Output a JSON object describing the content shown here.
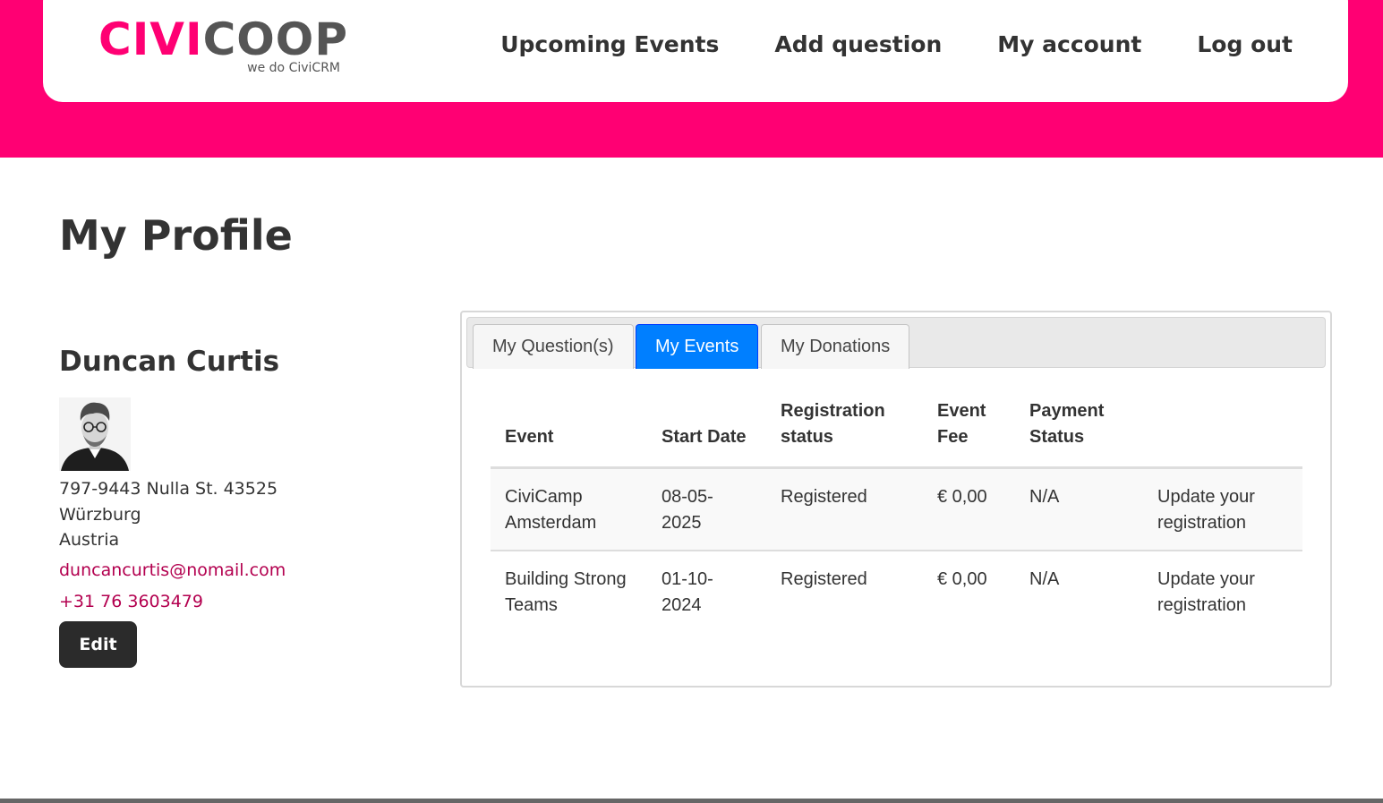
{
  "brand": {
    "logo_primary": "CIVI",
    "logo_secondary": "COOP",
    "logo_tagline": "we do CiviCRM",
    "accent_color": "#ff0073"
  },
  "nav": {
    "items": [
      {
        "label": "Upcoming Events"
      },
      {
        "label": "Add question"
      },
      {
        "label": "My account"
      },
      {
        "label": "Log out"
      }
    ]
  },
  "page": {
    "title": "My Profile"
  },
  "profile": {
    "name": "Duncan Curtis",
    "address_lines": [
      "797-9443 Nulla St. 43525",
      "Würzburg",
      "Austria"
    ],
    "email": "duncancurtis@nomail.com",
    "phone": "+31 76 3603479",
    "edit_label": "Edit"
  },
  "tabs": {
    "items": [
      {
        "label": "My Question(s)",
        "active": false
      },
      {
        "label": "My Events",
        "active": true
      },
      {
        "label": "My Donations",
        "active": false
      }
    ]
  },
  "events_table": {
    "headers": [
      "Event",
      "Start Date",
      "Registration status",
      "Event Fee",
      "Payment Status",
      ""
    ],
    "rows": [
      {
        "event": "CiviCamp Amsterdam",
        "start_date": "08-05-2025",
        "status": "Registered",
        "fee": "€ 0,00",
        "payment": "N/A",
        "action": "Update your registration"
      },
      {
        "event": "Building Strong Teams",
        "start_date": "01-10-2024",
        "status": "Registered",
        "fee": "€ 0,00",
        "payment": "N/A",
        "action": "Update your registration"
      }
    ]
  }
}
